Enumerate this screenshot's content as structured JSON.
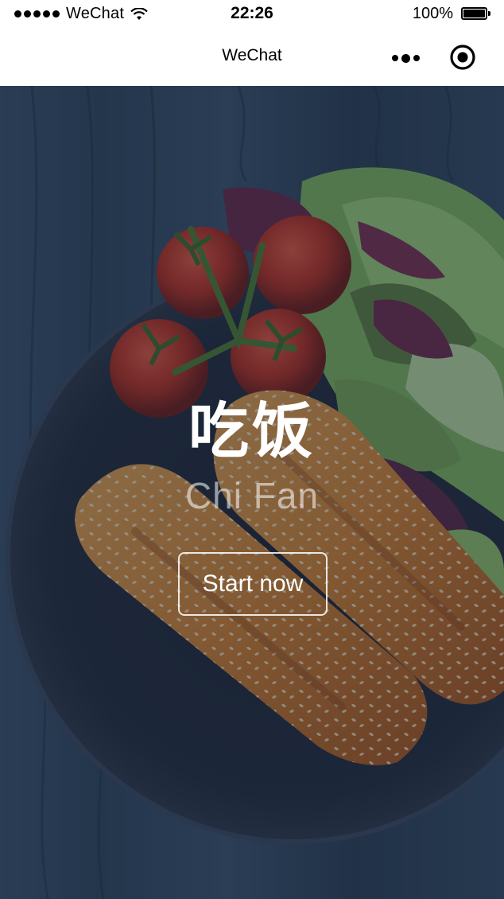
{
  "status_bar": {
    "carrier": "WeChat",
    "time": "22:26",
    "battery_percent": "100%",
    "signal_icon": "signal-dots-icon",
    "wifi_icon": "wifi-icon",
    "battery_icon": "battery-icon"
  },
  "nav": {
    "title": "WeChat",
    "more_icon": "more-dots-icon",
    "close_icon": "target-circle-icon"
  },
  "hero": {
    "title": "吃饭",
    "subtitle": "Chi Fan",
    "start_label": "Start now"
  },
  "colors": {
    "overlay": "#16243c",
    "text": "#ffffff",
    "nav_background": "#ffffff"
  }
}
